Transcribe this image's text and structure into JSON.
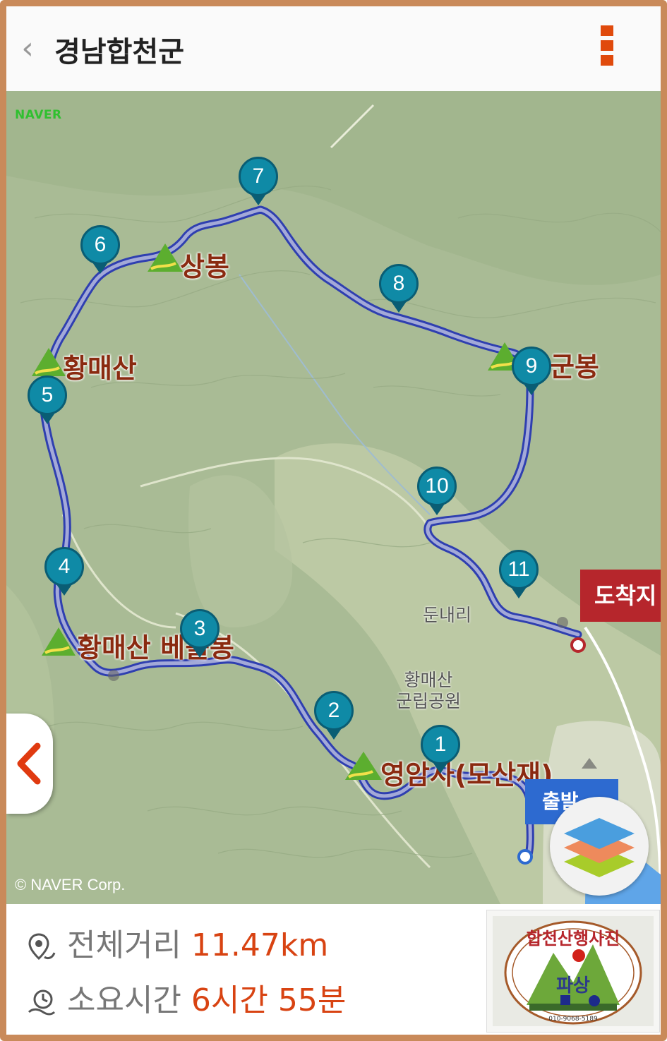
{
  "header": {
    "back_icon": "chevron-left-icon",
    "title": "경남합천군",
    "menu_icon": "more-vertical-icon"
  },
  "map": {
    "provider_logo": "NAVER",
    "copyright": "© NAVER Corp.",
    "peaks": [
      {
        "name": "상봉"
      },
      {
        "name": "황매산"
      },
      {
        "name": "군봉"
      },
      {
        "name": "황매산 베틀봉"
      },
      {
        "name": "영암사(모산재)"
      }
    ],
    "places": [
      {
        "name": "둔내리"
      },
      {
        "name": "황매산\n군립공원"
      }
    ],
    "waypoints": [
      "1",
      "2",
      "3",
      "4",
      "5",
      "6",
      "7",
      "8",
      "9",
      "10",
      "11"
    ],
    "arrival_label": "도착지",
    "start_label": "출발",
    "route_color": "#2f3fb0",
    "waypoint_color": "#0f8aa6",
    "arrival_color": "#b6262c",
    "start_color": "#2d6ad0"
  },
  "controls": {
    "side_toggle_icon": "chevron-left-icon",
    "layers_icon": "layers-icon"
  },
  "summary": {
    "distance_label": "전체거리",
    "distance_value": "11.47km",
    "distance_icon": "route-pin-icon",
    "duration_label": "소요시간",
    "duration_value": "6시간 55분",
    "duration_icon": "clock-icon"
  },
  "badge": {
    "text": "합천산행사진",
    "logo_text": "파상",
    "phone": "010-9068-5189"
  }
}
